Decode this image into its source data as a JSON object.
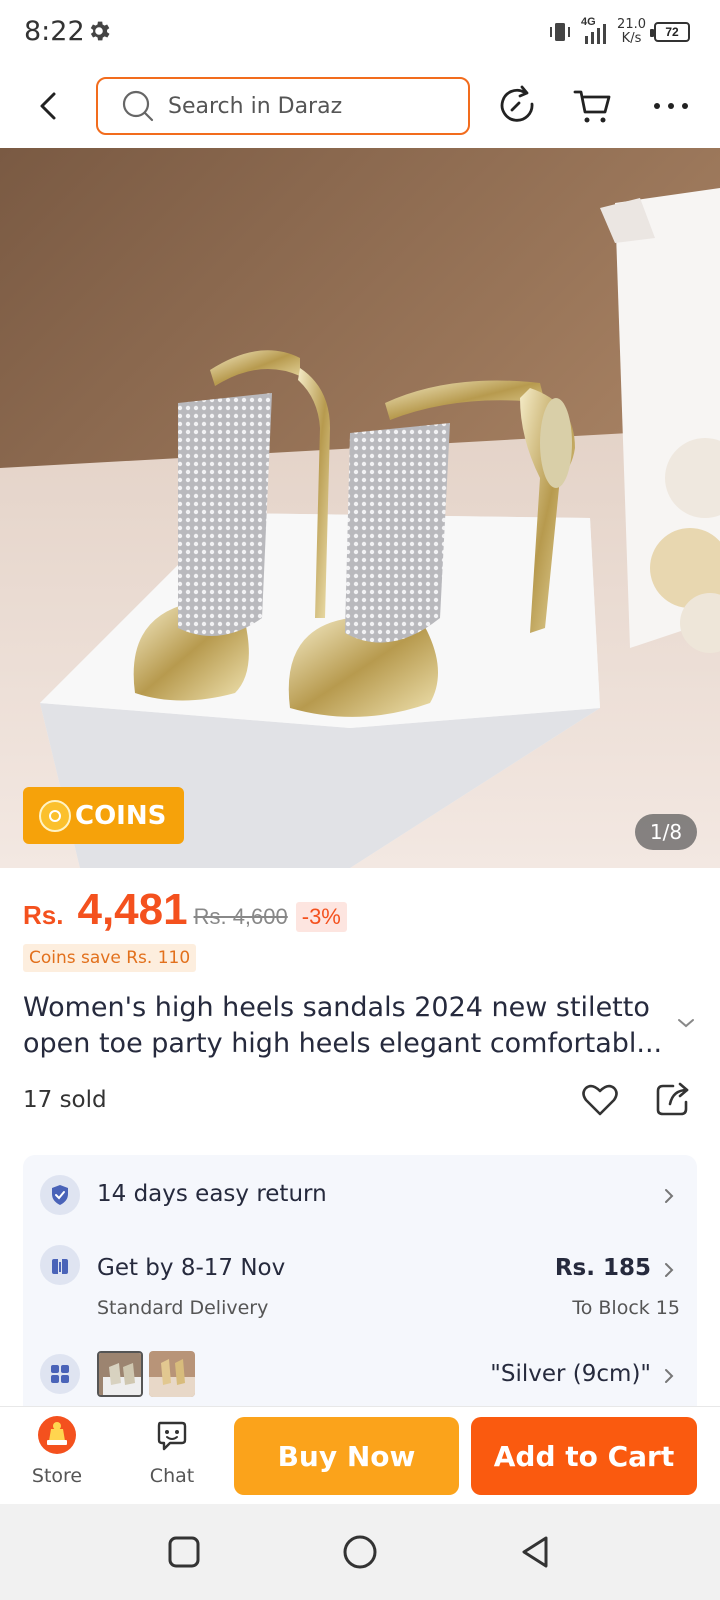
{
  "status_bar": {
    "time": "8:22",
    "network": "4G",
    "speed_value": "21.0",
    "speed_unit": "K/s",
    "battery": "72"
  },
  "header": {
    "search_placeholder": "Search in Daraz",
    "icons": [
      "back-icon",
      "search-icon",
      "refresh-icon",
      "cart-icon",
      "more-icon"
    ]
  },
  "gallery": {
    "coins_label": "COINS",
    "page_indicator": "1/8"
  },
  "product": {
    "currency": "Rs.",
    "price": "4,481",
    "old_price": "Rs. 4,600",
    "discount": "-3%",
    "coins_save": "Coins save Rs. 110",
    "title": "Women's high heels sandals 2024 new stiletto open toe party high heels elegant comfortabl...",
    "sold": "17 sold"
  },
  "info": {
    "return_label": "14 days easy return",
    "delivery_label": "Get by 8-17 Nov",
    "delivery_type": "Standard Delivery",
    "delivery_price": "Rs. 185",
    "delivery_to": "To Block 15",
    "variant_label": "\"Silver (9cm)\""
  },
  "actions": {
    "store_label": "Store",
    "chat_label": "Chat",
    "buy_now_label": "Buy Now",
    "add_to_cart_label": "Add to Cart"
  },
  "colors": {
    "accent": "#f4511e",
    "buy_now": "#fba31b",
    "add_to_cart": "#fa5a0f",
    "coins": "#f6a20a"
  }
}
